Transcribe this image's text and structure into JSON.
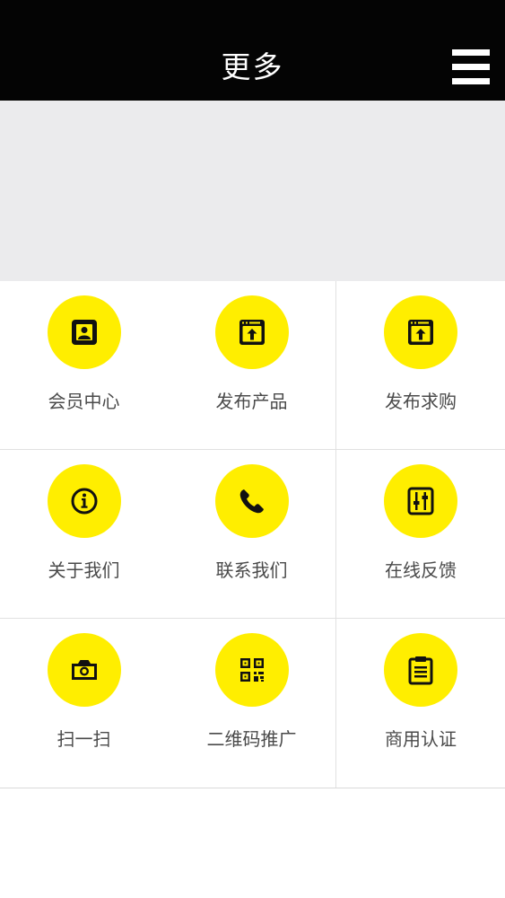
{
  "header": {
    "title": "更多",
    "menu_icon": "hamburger-menu-icon"
  },
  "colors": {
    "header_bg": "#040404",
    "banner_bg": "#ebebed",
    "icon_circle": "#ffee00"
  },
  "grid": {
    "items": [
      {
        "label": "会员中心",
        "icon": "member-card-icon"
      },
      {
        "label": "发布产品",
        "icon": "publish-upload-icon"
      },
      {
        "label": "发布求购",
        "icon": "publish-upload-icon"
      },
      {
        "label": "关于我们",
        "icon": "info-icon"
      },
      {
        "label": "联系我们",
        "icon": "phone-icon"
      },
      {
        "label": "在线反馈",
        "icon": "feedback-sliders-icon"
      },
      {
        "label": "扫一扫",
        "icon": "camera-icon"
      },
      {
        "label": "二维码推广",
        "icon": "qr-code-icon"
      },
      {
        "label": "商用认证",
        "icon": "clipboard-icon"
      }
    ]
  }
}
